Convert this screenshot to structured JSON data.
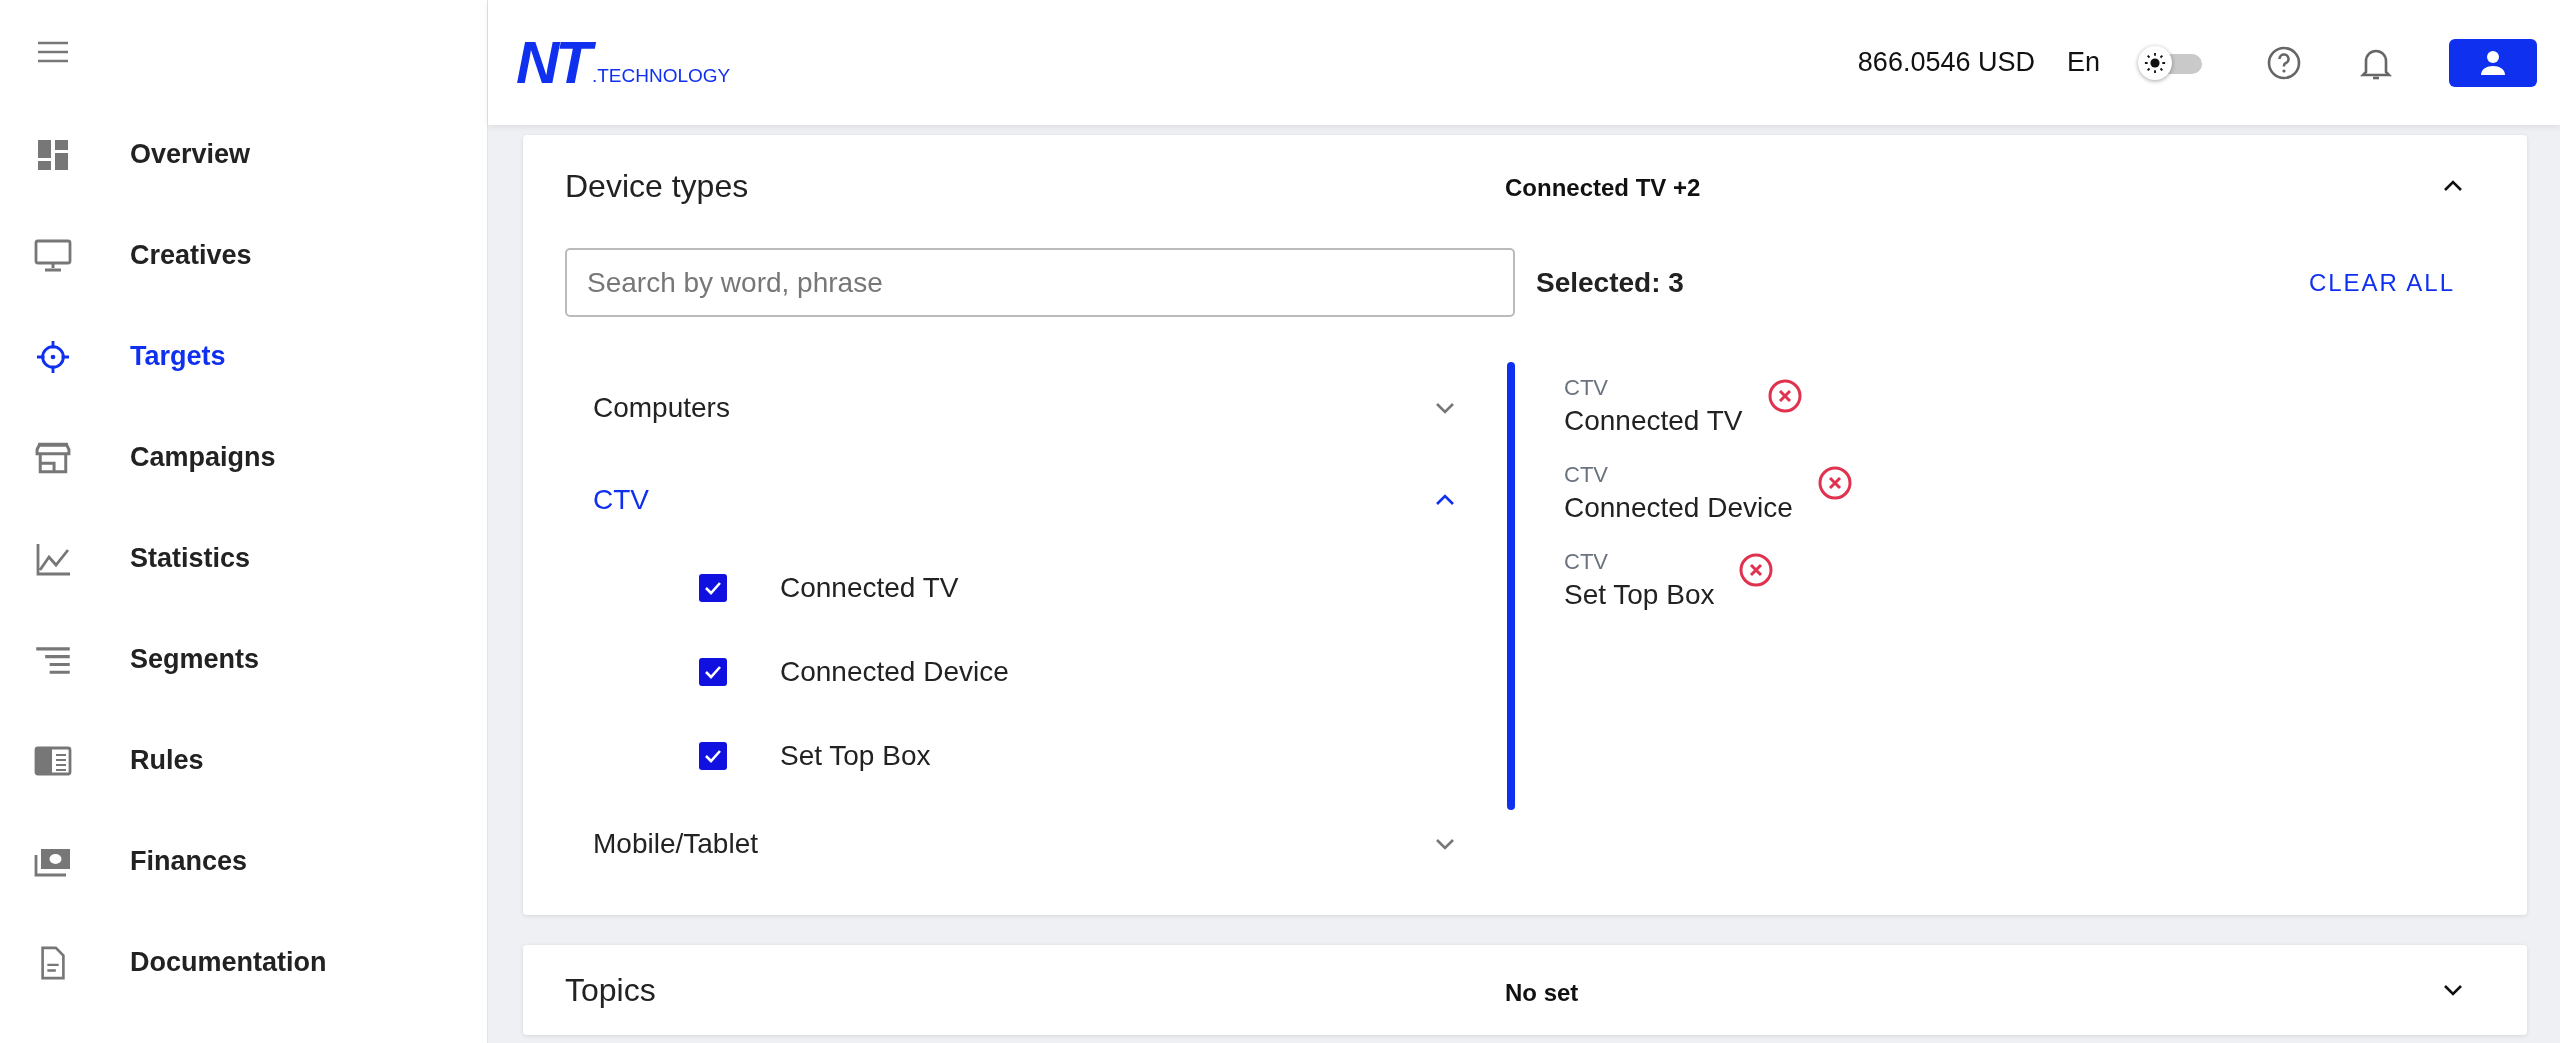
{
  "sidebar": {
    "items": [
      {
        "label": "Overview",
        "selected": false
      },
      {
        "label": "Creatives",
        "selected": false
      },
      {
        "label": "Targets",
        "selected": true
      },
      {
        "label": "Campaigns",
        "selected": false
      },
      {
        "label": "Statistics",
        "selected": false
      },
      {
        "label": "Segments",
        "selected": false
      },
      {
        "label": "Rules",
        "selected": false
      },
      {
        "label": "Finances",
        "selected": false
      },
      {
        "label": "Documentation",
        "selected": false
      }
    ]
  },
  "header": {
    "logo": {
      "mark": "NT",
      "suffix": ".TECHNOLOGY"
    },
    "balance": "866.0546 USD",
    "language": "En",
    "theme_toggle": {
      "on": false
    }
  },
  "sections": [
    {
      "title": "Device types",
      "summary": "Connected TV +2",
      "expanded": true,
      "search": {
        "placeholder": "Search by word, phrase"
      },
      "selected_count": "Selected: 3",
      "clear_all": "CLEAR ALL",
      "categories": [
        {
          "label": "Computers",
          "expanded": false
        },
        {
          "label": "CTV",
          "expanded": true,
          "children": [
            {
              "label": "Connected TV",
              "checked": true
            },
            {
              "label": "Connected Device",
              "checked": true
            },
            {
              "label": "Set Top Box",
              "checked": true
            }
          ]
        },
        {
          "label": "Mobile/Tablet",
          "expanded": false
        }
      ],
      "chosen": [
        {
          "group": "CTV",
          "label": "Connected TV"
        },
        {
          "group": "CTV",
          "label": "Connected Device"
        },
        {
          "group": "CTV",
          "label": "Set Top Box"
        }
      ]
    },
    {
      "title": "Topics",
      "summary": "No set",
      "expanded": false
    }
  ]
}
